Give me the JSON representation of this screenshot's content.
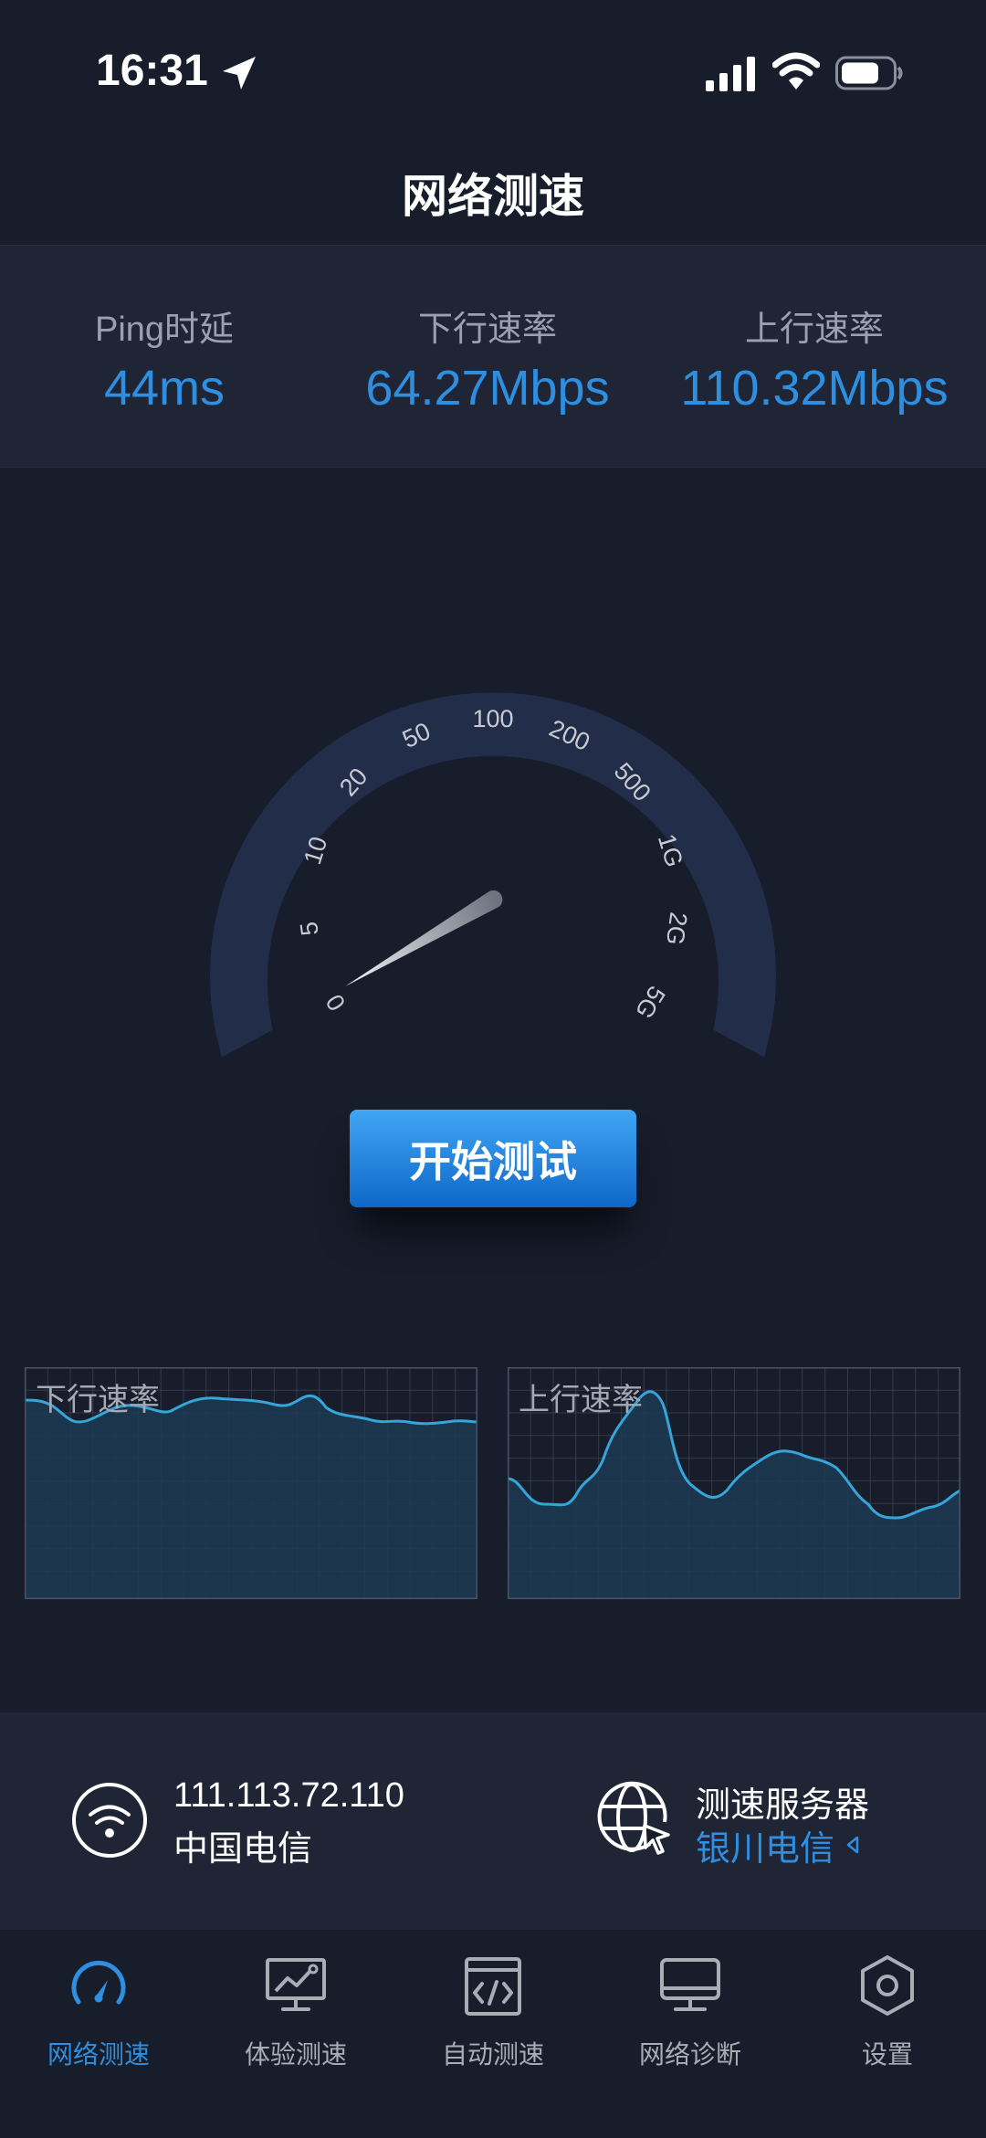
{
  "status_bar": {
    "time": "16:31"
  },
  "header": {
    "title": "网络测速"
  },
  "stats": {
    "ping": {
      "label": "Ping时延",
      "value": "44ms"
    },
    "download": {
      "label": "下行速率",
      "value": "64.27Mbps"
    },
    "upload": {
      "label": "上行速率",
      "value": "110.32Mbps"
    }
  },
  "gauge": {
    "scale_labels": [
      "0",
      "5",
      "10",
      "20",
      "50",
      "100",
      "200",
      "500",
      "1G",
      "2G",
      "5G"
    ],
    "needle_value": "0"
  },
  "start_button": {
    "label": "开始测试"
  },
  "charts": {
    "download": {
      "label": "下行速率"
    },
    "upload": {
      "label": "上行速率"
    }
  },
  "network": {
    "ip": "111.113.72.110",
    "isp": "中国电信"
  },
  "server": {
    "label": "测速服务器",
    "name": "银川电信"
  },
  "tabs": [
    {
      "label": "网络测速",
      "icon": "speedometer-icon",
      "active": true
    },
    {
      "label": "体验测速",
      "icon": "monitor-chart-icon",
      "active": false
    },
    {
      "label": "自动测速",
      "icon": "code-window-icon",
      "active": false
    },
    {
      "label": "网络诊断",
      "icon": "desktop-icon",
      "active": false
    },
    {
      "label": "设置",
      "icon": "hexagon-settings-icon",
      "active": false
    }
  ],
  "colors": {
    "background": "#181d2b",
    "panel": "#1f2535",
    "accent": "#2e8fe0",
    "gauge_arc": "#222d4a",
    "chart_line": "#34a6da"
  }
}
